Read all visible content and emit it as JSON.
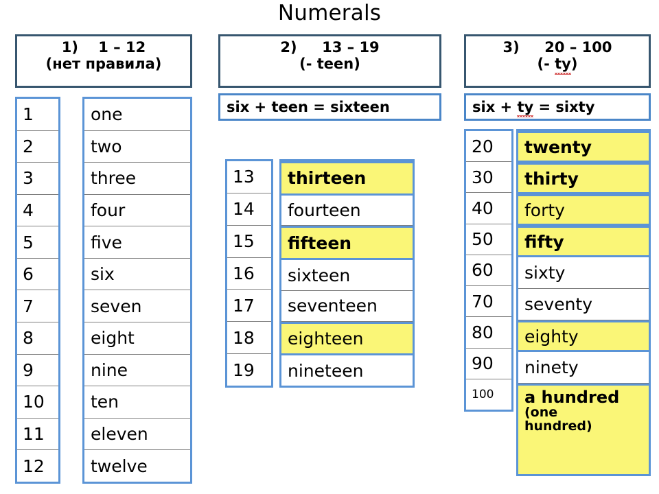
{
  "title": "Numerals",
  "sections": [
    {
      "id": "section-1",
      "header_line1": "1)    1 – 12",
      "header_line2": "(нет правила)",
      "numbers": [
        "1",
        "2",
        "3",
        "4",
        "5",
        "6",
        "7",
        "8",
        "9",
        "10",
        "11",
        "12"
      ],
      "words": [
        {
          "text": "one",
          "highlight": false,
          "bold": false
        },
        {
          "text": "two",
          "highlight": false,
          "bold": false
        },
        {
          "text": "three",
          "highlight": false,
          "bold": false
        },
        {
          "text": "four",
          "highlight": false,
          "bold": false
        },
        {
          "text": "five",
          "highlight": false,
          "bold": false
        },
        {
          "text": "six",
          "highlight": false,
          "bold": false
        },
        {
          "text": "seven",
          "highlight": false,
          "bold": false
        },
        {
          "text": "eight",
          "highlight": false,
          "bold": false
        },
        {
          "text": "nine",
          "highlight": false,
          "bold": false
        },
        {
          "text": "ten",
          "highlight": false,
          "bold": false
        },
        {
          "text": "eleven",
          "highlight": false,
          "bold": false
        },
        {
          "text": "twelve",
          "highlight": false,
          "bold": false
        }
      ]
    },
    {
      "id": "section-2",
      "header_line1": "2)     13 – 19",
      "header_line2": "(- teen)",
      "formula": "six + teen = sixteen",
      "numbers": [
        "13",
        "14",
        "15",
        "16",
        "17",
        "18",
        "19"
      ],
      "words": [
        {
          "text": "thirteen",
          "highlight": true,
          "bold": true
        },
        {
          "text": "fourteen",
          "highlight": false,
          "bold": false
        },
        {
          "text": "fifteen",
          "highlight": true,
          "bold": true
        },
        {
          "text": "sixteen",
          "highlight": false,
          "bold": false
        },
        {
          "text": "seventeen",
          "highlight": false,
          "bold": false
        },
        {
          "text": "eighteen",
          "highlight": true,
          "bold": false
        },
        {
          "text": "nineteen",
          "highlight": false,
          "bold": false
        }
      ]
    },
    {
      "id": "section-3",
      "header_line1": "3)     20 – 100",
      "header_line2_prefix": "(- ",
      "header_line2_misspelled": "ty",
      "header_line2_suffix": ")",
      "formula_prefix": "six + ",
      "formula_misspelled": "ty",
      "formula_suffix": " = sixty",
      "numbers": [
        "20",
        "30",
        "40",
        "50",
        "60",
        "70",
        "80",
        "90",
        "100"
      ],
      "words": [
        {
          "text": "twenty",
          "highlight": true,
          "bold": true
        },
        {
          "text": "thirty",
          "highlight": true,
          "bold": true
        },
        {
          "text": "forty",
          "highlight": true,
          "bold": false
        },
        {
          "text": "fifty",
          "highlight": true,
          "bold": true
        },
        {
          "text": "sixty",
          "highlight": false,
          "bold": false
        },
        {
          "text": "seventy",
          "highlight": false,
          "bold": false
        },
        {
          "text": "eighty",
          "highlight": true,
          "bold": false
        },
        {
          "text": "ninety",
          "highlight": false,
          "bold": false
        }
      ],
      "hundred": {
        "line1": "a hundred",
        "line2": "(one",
        "line3": "hundred)",
        "highlight": true
      }
    }
  ],
  "colors": {
    "header_border": "#37566f",
    "table_border": "#5b94d6",
    "formula_border": "#4a86c8",
    "highlight": "#faf677",
    "row_divider": "#7d7d7d",
    "text": "#000000",
    "spellcheck": "#d03a3a"
  }
}
